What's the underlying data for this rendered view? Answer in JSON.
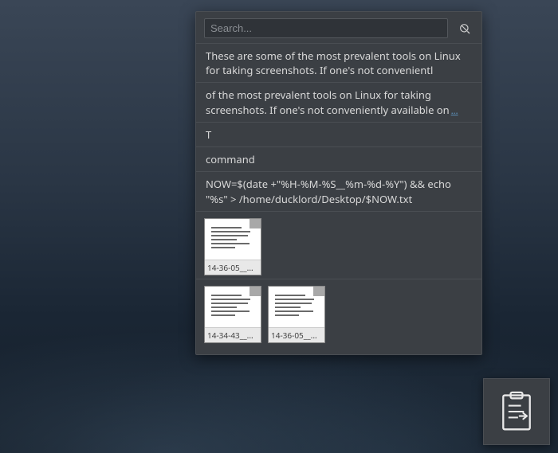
{
  "search": {
    "placeholder": "Search..."
  },
  "clips": [
    {
      "text": "These are some of the most prevalent tools on Linux for taking screenshots. If one's not convenientl"
    },
    {
      "text": "of the most prevalent tools on Linux for taking screenshots. If one's not conveniently available on",
      "hasMore": true,
      "moreLabel": "..."
    },
    {
      "text": "T"
    },
    {
      "text": "command"
    },
    {
      "text": "NOW=$(date +\"%H-%M-%S__%m-%d-%Y\") && echo \"%s\" > /home/ducklord/Desktop/$NOW.txt"
    }
  ],
  "fileGroups": [
    {
      "items": [
        {
          "caption": "14-36-05__..."
        }
      ]
    },
    {
      "items": [
        {
          "caption": "14-34-43__..."
        },
        {
          "caption": "14-36-05__..."
        }
      ]
    }
  ]
}
